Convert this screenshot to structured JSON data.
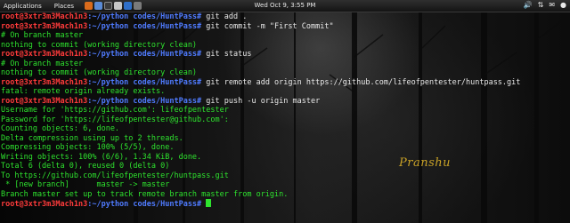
{
  "panel": {
    "applications": "Applications",
    "places": "Places",
    "clock": "Wed Oct  9,  3:55 PM",
    "tray_icons": [
      "volume-icon",
      "network-icon",
      "mail-icon",
      "user-icon"
    ]
  },
  "signature": "Pranshu",
  "colors": {
    "prompt": "#ff3b3b",
    "path": "#4f7bff",
    "output": "#2ee32e",
    "command": "#e8e8e8"
  },
  "terminal": {
    "lines": [
      {
        "type": "cmd",
        "prompt": "root@3xtr3m3Mach1n3",
        "path": ":~/python codes/HuntPass#",
        "text": " git add ."
      },
      {
        "type": "cmd",
        "prompt": "root@3xtr3m3Mach1n3",
        "path": ":~/python codes/HuntPass#",
        "text": " git commit -m \"First Commit\""
      },
      {
        "type": "out",
        "text": "# On branch master"
      },
      {
        "type": "out",
        "text": "nothing to commit (working directory clean)"
      },
      {
        "type": "cmd",
        "prompt": "root@3xtr3m3Mach1n3",
        "path": ":~/python codes/HuntPass#",
        "text": " git status"
      },
      {
        "type": "out",
        "text": "# On branch master"
      },
      {
        "type": "out",
        "text": "nothing to commit (working directory clean)"
      },
      {
        "type": "cmd",
        "prompt": "root@3xtr3m3Mach1n3",
        "path": ":~/python codes/HuntPass#",
        "text": " git remote add origin https://github.com/lifeofpentester/huntpass.git"
      },
      {
        "type": "out",
        "text": "fatal: remote origin already exists."
      },
      {
        "type": "cmd",
        "prompt": "root@3xtr3m3Mach1n3",
        "path": ":~/python codes/HuntPass#",
        "text": " git push -u origin master"
      },
      {
        "type": "out",
        "text": "Username for 'https://github.com': lifeofpentester"
      },
      {
        "type": "out",
        "text": "Password for 'https://lifeofpentester@github.com':"
      },
      {
        "type": "out",
        "text": "Counting objects: 6, done."
      },
      {
        "type": "out",
        "text": "Delta compression using up to 2 threads."
      },
      {
        "type": "out",
        "text": "Compressing objects: 100% (5/5), done."
      },
      {
        "type": "out",
        "text": "Writing objects: 100% (6/6), 1.34 KiB, done."
      },
      {
        "type": "out",
        "text": "Total 6 (delta 0), reused 0 (delta 0)"
      },
      {
        "type": "out",
        "text": "To https://github.com/lifeofpentester/huntpass.git"
      },
      {
        "type": "out",
        "text": " * [new branch]      master -> master"
      },
      {
        "type": "out",
        "text": "Branch master set up to track remote branch master from origin."
      },
      {
        "type": "cmd",
        "prompt": "root@3xtr3m3Mach1n3",
        "path": ":~/python codes/HuntPass#",
        "text": " ",
        "cursor": true
      }
    ]
  }
}
